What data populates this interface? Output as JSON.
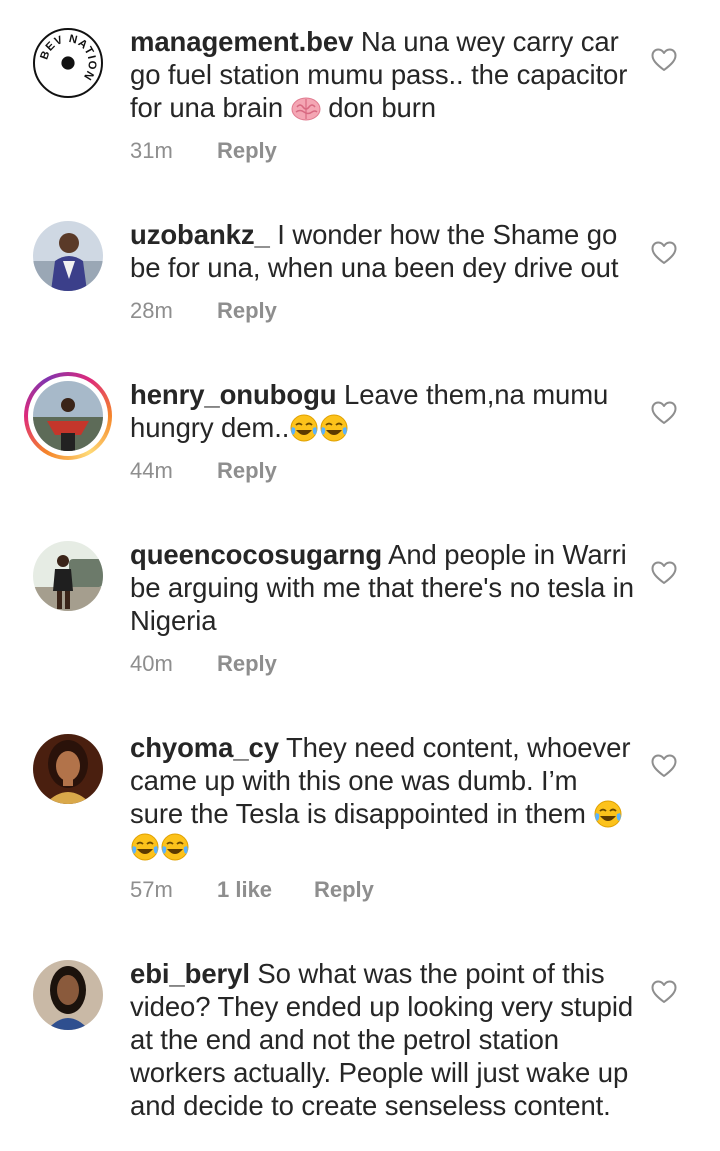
{
  "comments": [
    {
      "username": "management.bev",
      "text_before": "Na una wey carry car go fuel station mumu pass.. the capacitor for una brain ",
      "emoji_mid": "brain-emoji",
      "text_after": " don burn",
      "time": "31m",
      "likes": "",
      "reply": "Reply",
      "logo_text": "BEV NATION",
      "avatar_style": "logo"
    },
    {
      "username": "uzobankz_",
      "text": "I wonder how the Shame go be for una, when una been dey drive out",
      "time": "28m",
      "likes": "",
      "reply": "Reply",
      "avatar_style": "photo"
    },
    {
      "username": "henry_onubogu",
      "text": "Leave them,na mumu hungry dem..",
      "emoji_trail": [
        "laughing-tears-emoji",
        "laughing-tears-emoji"
      ],
      "time": "44m",
      "likes": "",
      "reply": "Reply",
      "avatar_style": "photo-story"
    },
    {
      "username": "queencocosugarng",
      "text": "And people in Warri be arguing with me that there's no tesla in Nigeria",
      "time": "40m",
      "likes": "",
      "reply": "Reply",
      "avatar_style": "photo"
    },
    {
      "username": "chyoma_cy",
      "text": "They need content, whoever came up with this one was dumb. I’m sure the Tesla is disappointed in them",
      "emoji_trail": [
        "laughing-tears-emoji",
        "laughing-tears-emoji",
        "laughing-tears-emoji"
      ],
      "time": "57m",
      "likes": "1 like",
      "reply": "Reply",
      "avatar_style": "photo"
    },
    {
      "username": "ebi_beryl",
      "text": "So what was the point of this video? They ended up looking very stupid at the end and not the petrol station workers actually. People will just wake up and decide to create senseless content.",
      "time": "",
      "likes": "",
      "reply": "",
      "avatar_style": "photo"
    }
  ],
  "colors": {
    "text": "#262626",
    "meta": "#8e8e8e",
    "story_ring_start": "#f58529",
    "story_ring_end": "#dd2a7b"
  }
}
